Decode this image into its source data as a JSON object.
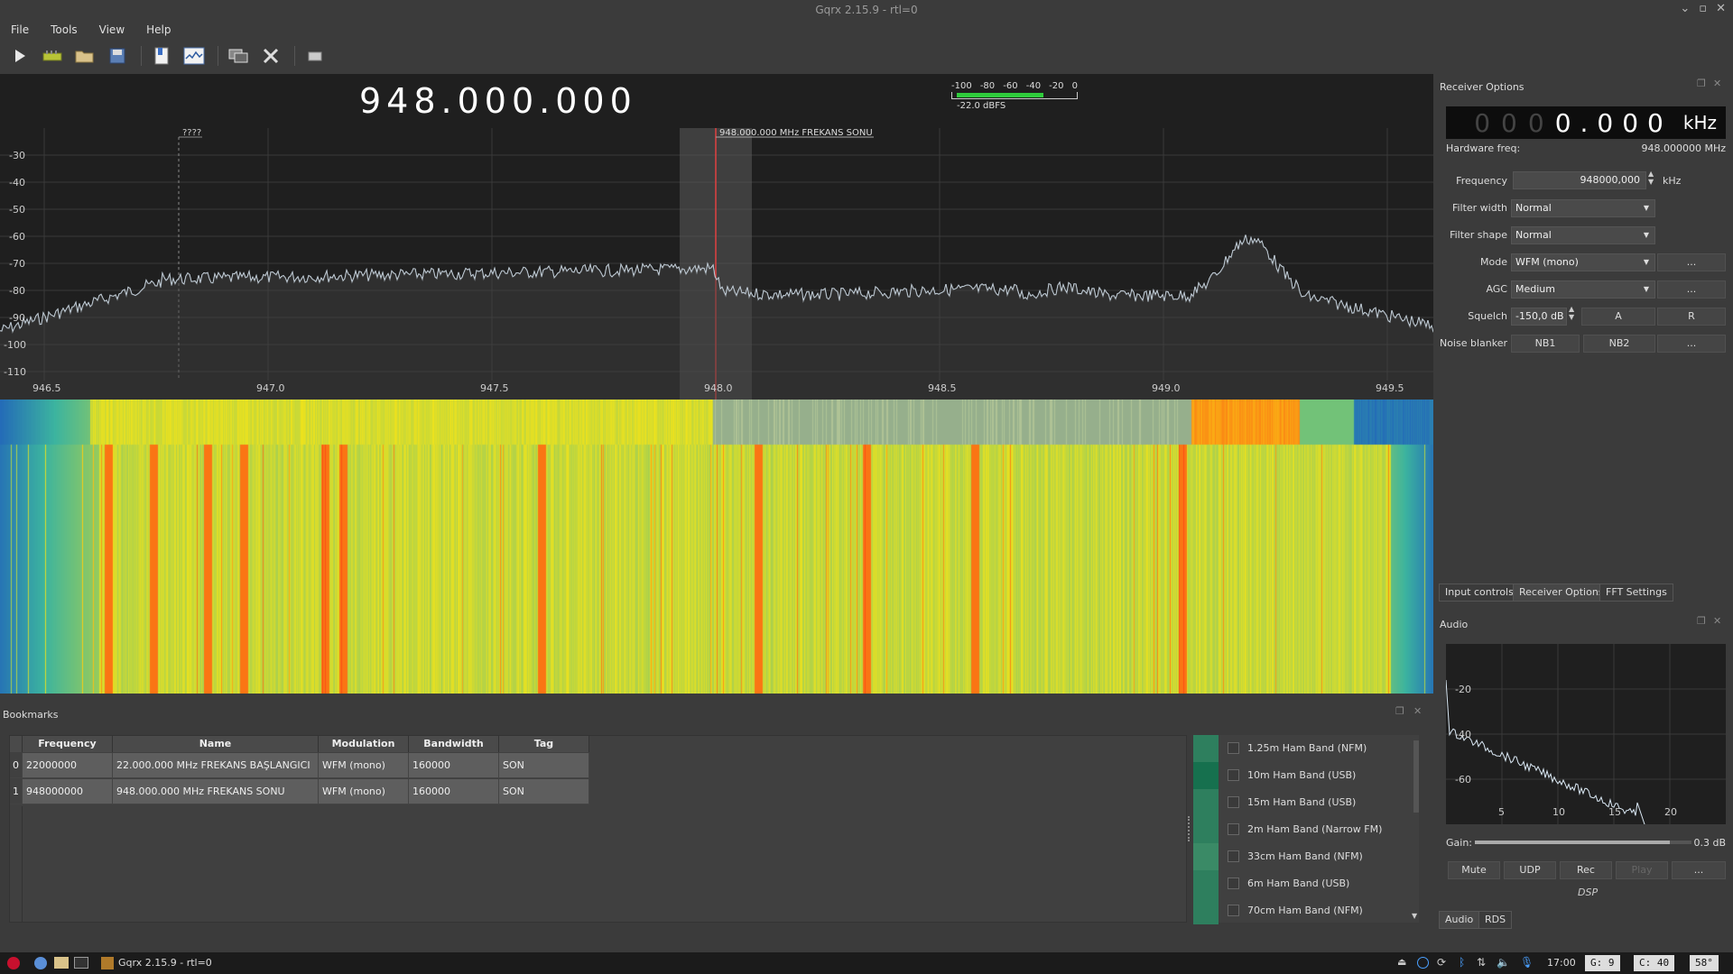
{
  "window": {
    "title": "Gqrx 2.15.9 - rtl=0"
  },
  "menu": [
    "File",
    "Tools",
    "View",
    "Help"
  ],
  "toolbar_icons": [
    "play-icon",
    "hardware-icon",
    "open-icon",
    "save-icon",
    "bookmark-icon",
    "spectrum-icon",
    "remote-icon",
    "settings-icon",
    "window-icon"
  ],
  "display": {
    "center_freq": "948.000.000",
    "smeter_scale": [
      "-100",
      "-80",
      "-60",
      "-40",
      "-20",
      "0"
    ],
    "smeter_value": "-22.0 dBFS",
    "smeter_level": 0.75,
    "y_ticks": [
      "-30",
      "-40",
      "-50",
      "-60",
      "-70",
      "-80",
      "-90",
      "-100",
      "-110"
    ],
    "x_ticks": [
      "946.5",
      "947.0",
      "947.5",
      "948.0",
      "948.5",
      "949.0",
      "949.5"
    ],
    "marker_label_left": "????",
    "marker_label_main": "948.000.000 MHz FREKANS SONU"
  },
  "receiver": {
    "panel_title": "Receiver Options",
    "freq_digits_dim": [
      "0",
      "0",
      "0"
    ],
    "freq_digits_bright": "0.000",
    "freq_unit": "kHz",
    "hw_freq_label": "Hardware freq:",
    "hw_freq_value": "948.000000 MHz",
    "frequency_label": "Frequency",
    "frequency_value": "948000,000",
    "frequency_unit": "kHz",
    "filter_width_label": "Filter width",
    "filter_width_value": "Normal",
    "filter_shape_label": "Filter shape",
    "filter_shape_value": "Normal",
    "mode_label": "Mode",
    "mode_value": "WFM (mono)",
    "agc_label": "AGC",
    "agc_value": "Medium",
    "squelch_label": "Squelch",
    "squelch_value": "-150,0 dB",
    "squelch_a": "A",
    "squelch_r": "R",
    "noise_blanker_label": "Noise blanker",
    "nb1": "NB1",
    "nb2": "NB2",
    "more": "...",
    "tabs": [
      "Input controls",
      "Receiver Options",
      "FFT Settings"
    ]
  },
  "audio": {
    "panel_title": "Audio",
    "y_ticks": [
      "-20",
      "-40",
      "-60"
    ],
    "x_ticks": [
      "5",
      "10",
      "15",
      "20"
    ],
    "gain_label": "Gain:",
    "gain_value": "0.3 dB",
    "gain_level": 0.9,
    "buttons": [
      "Mute",
      "UDP",
      "Rec",
      "Play",
      "..."
    ],
    "dsp_label": "DSP",
    "tabs": [
      "Audio",
      "RDS"
    ]
  },
  "bookmarks": {
    "panel_title": "Bookmarks",
    "headers": [
      "Frequency",
      "Name",
      "Modulation",
      "Bandwidth",
      "Tag"
    ],
    "rows": [
      {
        "idx": "0",
        "freq": "22000000",
        "name": "22.000.000 MHz FREKANS BAŞLANGICI",
        "mod": "WFM (mono)",
        "bw": "160000",
        "tag": "SON"
      },
      {
        "idx": "1",
        "freq": "948000000",
        "name": "948.000.000 MHz FREKANS SONU",
        "mod": "WFM (mono)",
        "bw": "160000",
        "tag": "SON"
      }
    ],
    "tags": [
      "1.25m Ham Band (NFM)",
      "10m Ham Band (USB)",
      "15m Ham Band (USB)",
      "2m Ham Band (Narrow FM)",
      "33cm Ham Band (NFM)",
      "6m Ham Band (USB)",
      "70cm Ham Band (NFM)"
    ],
    "tag_colors": [
      "#2e7f5e",
      "#1f7a5a",
      "#2e7f5e",
      "#2e7f5e",
      "#3a8a66",
      "#2e7f5e",
      "#2e7f5e"
    ]
  },
  "taskbar": {
    "app_label": "Gqrx 2.15.9 - rtl=0",
    "clock": "17:00",
    "g_label": "G:  9",
    "c_label": "C: 40",
    "temp": "58°"
  }
}
